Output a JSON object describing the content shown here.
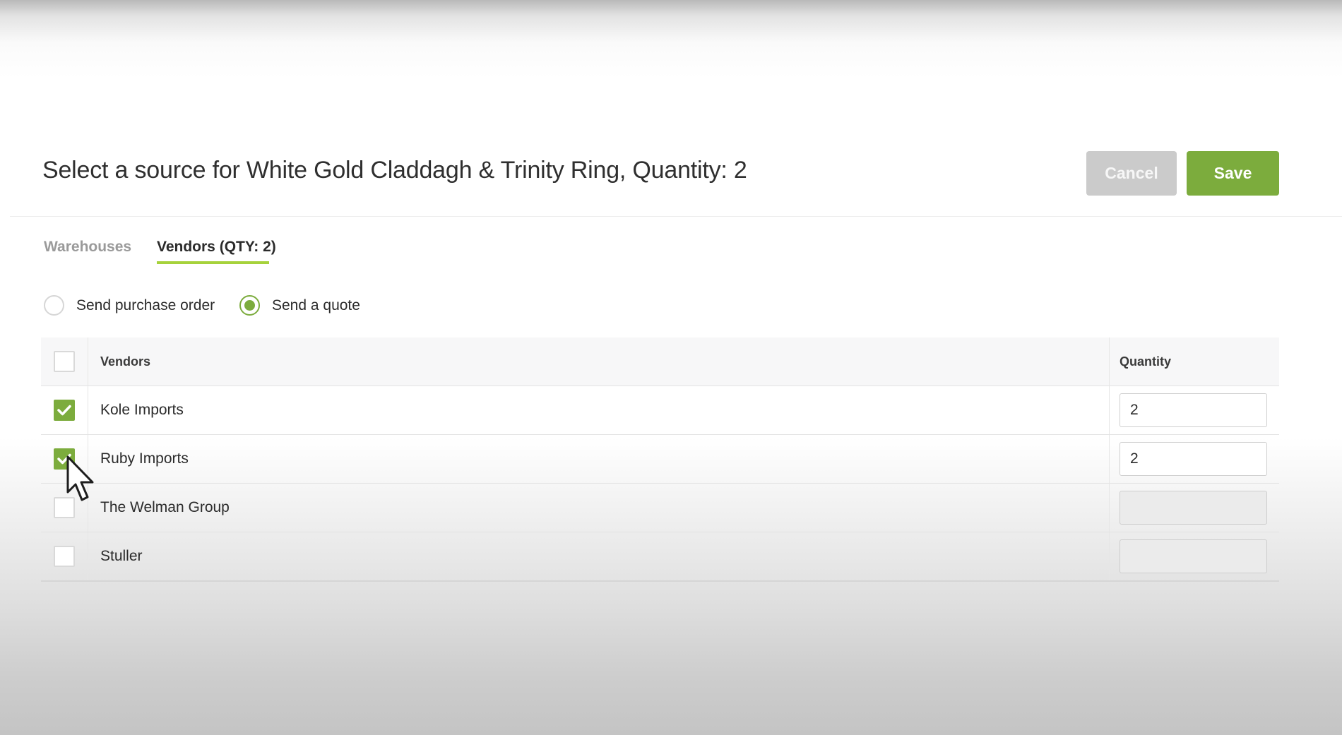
{
  "header": {
    "title": "Select a source for White Gold Claddagh & Trinity Ring, Quantity: 2",
    "cancel_label": "Cancel",
    "save_label": "Save"
  },
  "tabs": [
    {
      "label": "Warehouses",
      "active": false
    },
    {
      "label": "Vendors (QTY: 2)",
      "active": true
    }
  ],
  "options": {
    "send_purchase_order": {
      "label": "Send purchase order",
      "selected": false
    },
    "send_quote": {
      "label": "Send a quote",
      "selected": true
    }
  },
  "table": {
    "headers": {
      "vendors": "Vendors",
      "quantity": "Quantity"
    },
    "rows": [
      {
        "name": "Kole Imports",
        "checked": true,
        "quantity": "2"
      },
      {
        "name": "Ruby Imports",
        "checked": true,
        "quantity": "2"
      },
      {
        "name": "The Welman Group",
        "checked": false,
        "quantity": ""
      },
      {
        "name": "Stuller",
        "checked": false,
        "quantity": ""
      }
    ]
  },
  "colors": {
    "accent_green": "#7cac3d",
    "tab_underline": "#a6d23b",
    "cancel_gray": "#cbcbcb"
  },
  "icons": {
    "checkbox_checked": "checkmark-icon",
    "pointer": "mouse-cursor-icon"
  }
}
